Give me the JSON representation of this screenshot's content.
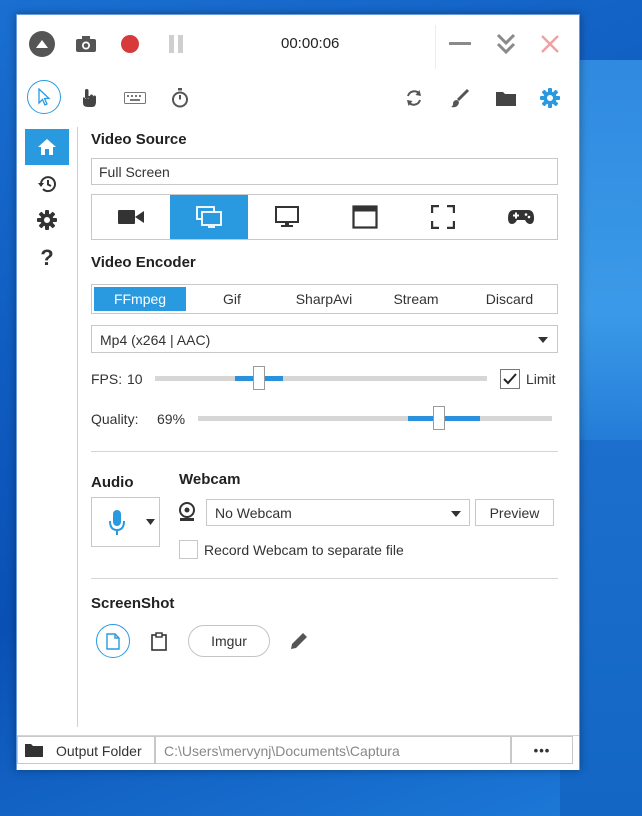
{
  "titlebar": {
    "timer": "00:00:06"
  },
  "video_source": {
    "title": "Video Source",
    "value": "Full Screen",
    "selected_index": 1,
    "options": [
      "webcam-icon",
      "screen-icon",
      "monitor-icon",
      "window-icon",
      "region-icon",
      "gamepad-icon"
    ]
  },
  "video_encoder": {
    "title": "Video Encoder",
    "tabs": [
      "FFmpeg",
      "Gif",
      "SharpAvi",
      "Stream",
      "Discard"
    ],
    "selected_tab": 0,
    "codec": "Mp4 (x264 | AAC)",
    "fps_label": "FPS:",
    "fps_value": "10",
    "limit_label": "Limit",
    "limit_checked": true,
    "quality_label": "Quality:",
    "quality_value": "69%"
  },
  "audio": {
    "title": "Audio"
  },
  "webcam": {
    "title": "Webcam",
    "selected": "No Webcam",
    "preview_label": "Preview",
    "separate_file_label": "Record Webcam to separate file",
    "separate_file_checked": false
  },
  "screenshot": {
    "title": "ScreenShot",
    "imgur_label": "Imgur"
  },
  "footer": {
    "output_folder_label": "Output Folder",
    "path": "C:\\Users\\mervynj\\Documents\\Captura",
    "more_label": "•••"
  },
  "colors": {
    "accent": "#2a9ae0",
    "record": "#d63a3a",
    "close": "#f0a0a0"
  }
}
